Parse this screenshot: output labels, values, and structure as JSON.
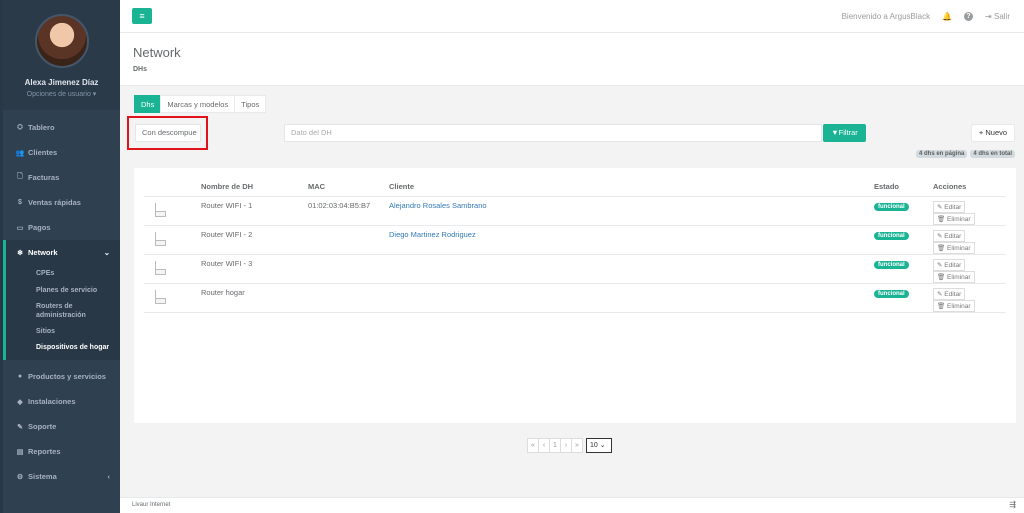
{
  "user": {
    "name": "Alexa Jimenez Díaz",
    "options": "Opciones de usuario ▾"
  },
  "sidebar": {
    "items": [
      {
        "icon": "tachometer-icon",
        "glyph": "⛭",
        "label": "Tablero"
      },
      {
        "icon": "users-icon",
        "glyph": "👥",
        "label": "Clientes"
      },
      {
        "icon": "file-icon",
        "glyph": "🗋",
        "label": "Facturas"
      },
      {
        "icon": "dollar-icon",
        "glyph": "$",
        "label": "Ventas rápidas"
      },
      {
        "icon": "money-icon",
        "glyph": "▭",
        "label": "Pagos"
      }
    ],
    "network": {
      "glyph": "❄",
      "label": "Network",
      "chevron": "⌄"
    },
    "subitems": [
      "CPEs",
      "Planes de servicio",
      "Routers de administración",
      "Sitios",
      "Dispositivos de hogar"
    ],
    "items2": [
      {
        "icon": "tag-icon",
        "glyph": "●",
        "label": "Productos y servicios"
      },
      {
        "icon": "plug-icon",
        "glyph": "◆",
        "label": "Instalaciones"
      },
      {
        "icon": "wrench-icon",
        "glyph": "✎",
        "label": "Soporte"
      },
      {
        "icon": "book-icon",
        "glyph": "▤",
        "label": "Reportes"
      },
      {
        "icon": "cogs-icon",
        "glyph": "⚙",
        "label": "Sistema",
        "chevron": "‹"
      }
    ]
  },
  "topbar": {
    "menu": "≡",
    "welcome": "Bienvenido a ArgusBlack",
    "logout": "Salir",
    "bell": "🔔",
    "help": "?",
    "logout_icon": "⇥"
  },
  "page": {
    "title": "Network",
    "breadcrumb": "DHs"
  },
  "tabs": [
    "Dhs",
    "Marcas y modelos",
    "Tipos"
  ],
  "filters": {
    "status_value": "Con descompue",
    "search_placeholder": "Dato del DH",
    "filter_label": "▼Filtrar",
    "new_label": "+ Nuevo",
    "badge_page": "4 dhs en página",
    "badge_total": "4 dhs en total"
  },
  "table": {
    "headers": [
      "",
      "Nombre de DH",
      "MAC",
      "Cliente",
      "Estado",
      "Acciones"
    ],
    "rows": [
      {
        "name": "Router WIFI - 1",
        "mac": "01:02:03:04:B5:B7",
        "client": "Alejandro Rosales Sambrano",
        "status": "funcional"
      },
      {
        "name": "Router WIFI - 2",
        "mac": "",
        "client": "Diego Martinez Rodriguez",
        "status": "funcional"
      },
      {
        "name": "Router WIFI - 3",
        "mac": "",
        "client": "",
        "status": "funcional"
      },
      {
        "name": "Router hogar",
        "mac": "",
        "client": "",
        "status": "funcional"
      }
    ],
    "edit_label": "✎ Editar",
    "delete_label": "🗑 Eliminar"
  },
  "pagination": {
    "first": "«",
    "prev": "‹",
    "page": "1",
    "next": "›",
    "last": "»",
    "per_page": "10 ⌄"
  },
  "footer": {
    "text": "Livaur Internet",
    "icon": "⇶"
  }
}
